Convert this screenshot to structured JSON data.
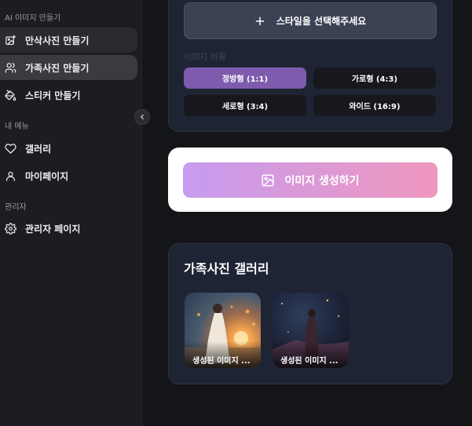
{
  "sidebar": {
    "sections": [
      {
        "label": "AI 이미지 만들기"
      },
      {
        "label": "내 메뉴"
      },
      {
        "label": "관리자"
      }
    ],
    "items": [
      {
        "label": "만삭사진 만들기",
        "icon": "image-sparkle-icon"
      },
      {
        "label": "가족사진 만들기",
        "icon": "users-icon"
      },
      {
        "label": "스티커 만들기",
        "icon": "paint-bucket-icon"
      },
      {
        "label": "갤러리",
        "icon": "heart-icon"
      },
      {
        "label": "마이페이지",
        "icon": "user-icon"
      },
      {
        "label": "관리자 페이지",
        "icon": "gear-icon"
      }
    ],
    "collapse_icon": "chevron-left-icon"
  },
  "style_select": {
    "label": "스타일을 선택해주세요",
    "icon": "plus-icon"
  },
  "ratio": {
    "label": "이미지 비율",
    "options": [
      {
        "label": "정방형 (1:1)",
        "selected": true
      },
      {
        "label": "가로형 (4:3)",
        "selected": false
      },
      {
        "label": "세로형 (3:4)",
        "selected": false
      },
      {
        "label": "와이드 (16:9)",
        "selected": false
      }
    ]
  },
  "generate": {
    "label": "이미지 생성하기",
    "icon": "image-icon"
  },
  "gallery": {
    "title": "가족사진 갤러리",
    "items": [
      {
        "caption": "생성된 이미지 ..."
      },
      {
        "caption": "생성된 이미지 ..."
      }
    ]
  },
  "colors": {
    "accent_purple": "#7e5bac",
    "gradient_start": "#c79bef",
    "gradient_end": "#ef97be",
    "card_bg": "#1e2433"
  }
}
